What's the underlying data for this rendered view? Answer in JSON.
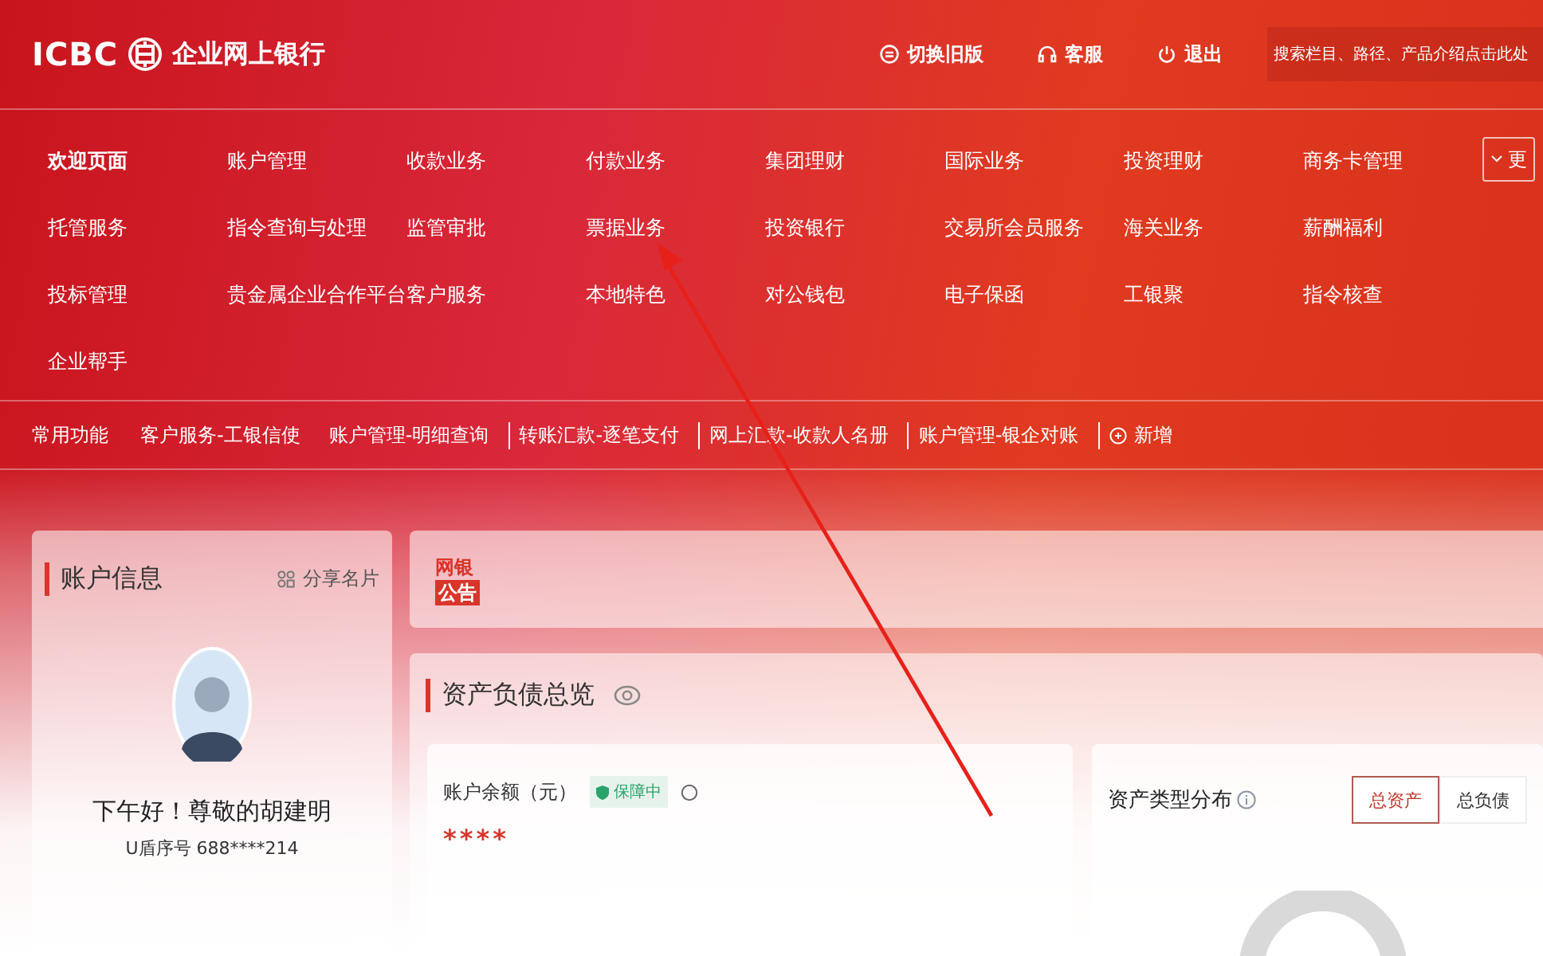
{
  "header": {
    "logo_text": "ICBC",
    "bank_name": "企业网上银行",
    "actions": [
      {
        "kind": "switch",
        "label": "切换旧版"
      },
      {
        "kind": "service",
        "label": "客服"
      },
      {
        "kind": "logout",
        "label": "退出"
      }
    ],
    "search": {
      "placeholder": "搜索栏目、路径、产品介绍点击此处"
    }
  },
  "nav": {
    "items": [
      {
        "label": "欢迎页面",
        "selected": true
      },
      {
        "label": "账户管理",
        "selected": false
      },
      {
        "label": "收款业务",
        "selected": false
      },
      {
        "label": "付款业务",
        "selected": false
      },
      {
        "label": "集团理财",
        "selected": false
      },
      {
        "label": "国际业务",
        "selected": false
      },
      {
        "label": "投资理财",
        "selected": false
      },
      {
        "label": "商务卡管理",
        "selected": false
      },
      {
        "label": "托管服务",
        "selected": false
      },
      {
        "label": "指令查询与处理",
        "selected": false
      },
      {
        "label": "监管审批",
        "selected": false
      },
      {
        "label": "票据业务",
        "selected": false
      },
      {
        "label": "投资银行",
        "selected": false
      },
      {
        "label": "交易所会员服务",
        "selected": false
      },
      {
        "label": "海关业务",
        "selected": false
      },
      {
        "label": "薪酬福利",
        "selected": false
      },
      {
        "label": "投标管理",
        "selected": false
      },
      {
        "label": "贵金属企业合作平台",
        "selected": false
      },
      {
        "label": "客户服务",
        "selected": false
      },
      {
        "label": "本地特色",
        "selected": false
      },
      {
        "label": "对公钱包",
        "selected": false
      },
      {
        "label": "电子保函",
        "selected": false
      },
      {
        "label": "工银聚",
        "selected": false
      },
      {
        "label": "指令核查",
        "selected": false
      },
      {
        "label": "企业帮手",
        "selected": false
      }
    ],
    "more_button": "更"
  },
  "quick_bar": {
    "label": "常用功能",
    "links": [
      "客户服务-工银信使",
      "账户管理-明细查询",
      "转账汇款-逐笔支付",
      "网上汇款-收款人名册",
      "账户管理-银企对账"
    ],
    "add_button": "新增"
  },
  "account_card": {
    "title": "账户信息",
    "share_link": "分享名片",
    "greeting": "下午好！尊敬的胡建明",
    "ukey": "U盾序号 688****214"
  },
  "announcement": {
    "badge_top": "网银",
    "badge_bottom": "公告"
  },
  "assets": {
    "title": "资产负债总览",
    "balance_label": "账户余额（元）",
    "status_badge": "保障中",
    "balance_value": "****",
    "distribution_title": "资产类型分布",
    "tabs": [
      {
        "label": "总资产",
        "selected": true
      },
      {
        "label": "总负债",
        "selected": false
      }
    ]
  }
}
